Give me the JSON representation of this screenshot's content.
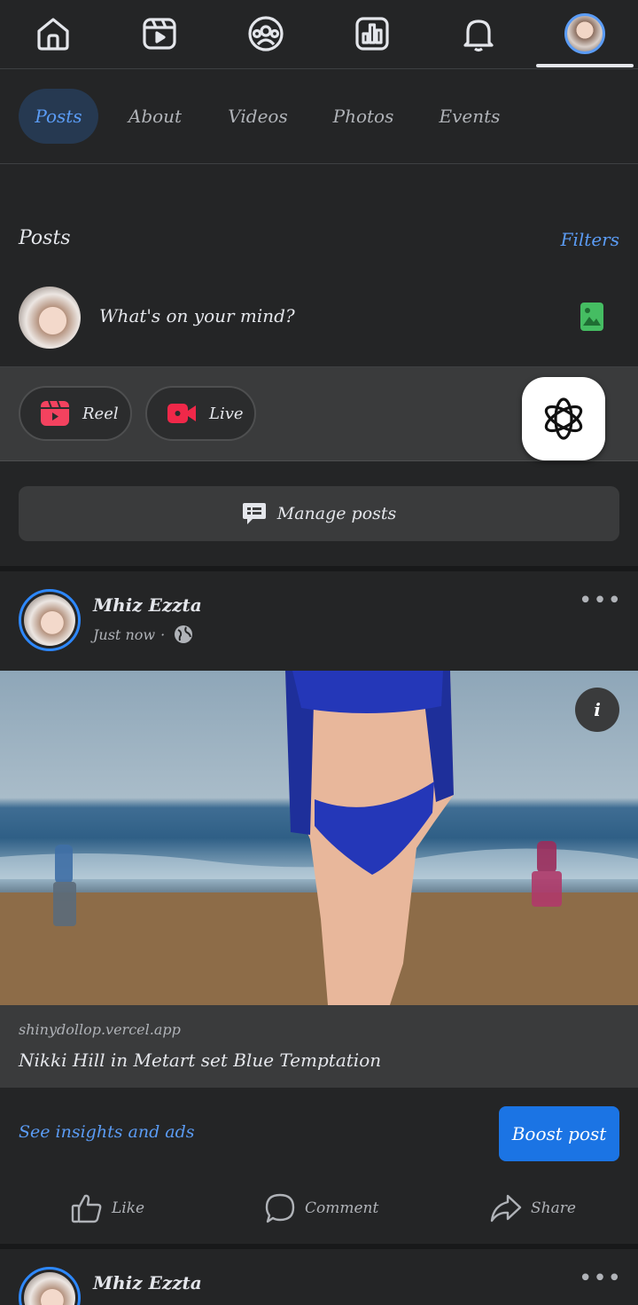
{
  "nav": {
    "items": [
      {
        "name": "home-icon"
      },
      {
        "name": "reels-icon"
      },
      {
        "name": "groups-icon"
      },
      {
        "name": "dashboard-icon"
      },
      {
        "name": "bell-icon"
      },
      {
        "name": "profile-avatar"
      }
    ],
    "active_index": 5
  },
  "tabs": {
    "items": [
      "Posts",
      "About",
      "Videos",
      "Photos",
      "Events"
    ],
    "active": "Posts"
  },
  "posts_section": {
    "title": "Posts",
    "filters_label": "Filters"
  },
  "composer": {
    "placeholder": "What's on your mind?",
    "photo_icon": "photo-icon"
  },
  "quick_actions": {
    "reel_label": "Reel",
    "live_label": "Live",
    "floating_icon": "openai-icon"
  },
  "manage_posts_label": "Manage posts",
  "post": {
    "author": "Mhiz Ezzta",
    "timestamp": "Just now",
    "separator": "·",
    "privacy_icon": "globe-icon",
    "more_label": "•••",
    "info_label": "i",
    "link_domain": "shinydollop.vercel.app",
    "link_title": "Nikki Hill in Metart set Blue Temptation",
    "insights_label": "See insights and ads",
    "boost_label": "Boost post",
    "actions": {
      "like": "Like",
      "comment": "Comment",
      "share": "Share"
    }
  },
  "next_post": {
    "author": "Mhiz Ezzta",
    "more_label": "•••"
  },
  "colors": {
    "background": "#242526",
    "accent": "#5b9cf5",
    "boost_button": "#1b74e4",
    "active_tab_bg": "#263951"
  }
}
